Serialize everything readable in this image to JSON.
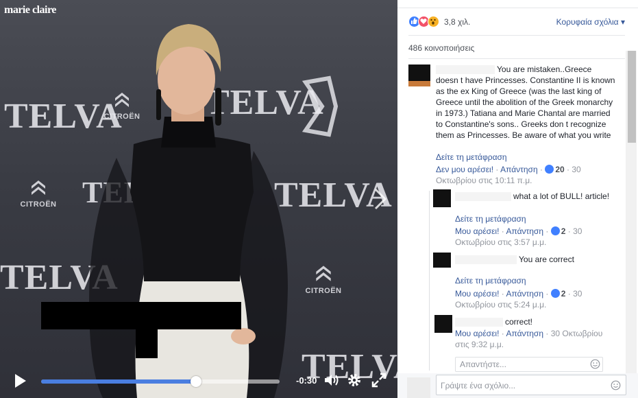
{
  "video": {
    "logo": "marie claire",
    "backdrop_brand": "TELVA",
    "backdrop_sponsor": "CITROËN",
    "controls": {
      "time_remaining": "-0:30",
      "progress": 0.65
    }
  },
  "panel": {
    "reactions": {
      "icons": [
        "like-icon",
        "love-icon",
        "wow-icon"
      ],
      "count": "3,8 χιλ."
    },
    "sort_label": "Κορυφαία σχόλια",
    "shares": "486 κοινοποιήσεις",
    "comments": [
      {
        "text": "You are mistaken..Greece doesn t have Princesses. Constantine II is known as the ex King of Greece (was the last king of Greece until the abolition of the Greek monarchy in 1973.) Tatiana and Marie Chantal are married to Constantine's sons.. Greeks don t recognize them as Princesses. Be aware of what you write",
        "translate": "Δείτε τη μετάφραση",
        "like": "Δεν μου αρέσει!",
        "reply": "Απάντηση",
        "likes": "20",
        "time": "30 Οκτωβρίου στις 10:11 π.μ."
      },
      {
        "text": "what a lot of BULL! article!",
        "translate": "Δείτε τη μετάφραση",
        "like": "Μου αρέσει!",
        "reply": "Απάντηση",
        "likes": "2",
        "time": "30 Οκτωβρίου στις 3:57 μ.μ."
      },
      {
        "text": "You are correct",
        "translate": "Δείτε τη μετάφραση",
        "like": "Μου αρέσει!",
        "reply": "Απάντηση",
        "likes": "2",
        "time": "30 Οκτωβρίου στις 5:24 μ.μ."
      },
      {
        "text": "correct!",
        "like": "Μου αρέσει!",
        "reply": "Απάντηση",
        "time": "30 Οκτωβρίου στις 9:32 μ.μ."
      }
    ],
    "reply_placeholder": "Απαντήστε...",
    "comment_placeholder": "Γράψτε ένα σχόλιο...",
    "colors": {
      "link": "#365899",
      "like_blue": "#4080ff",
      "love_red": "#f25268",
      "wow_yellow": "#f7b125"
    }
  }
}
